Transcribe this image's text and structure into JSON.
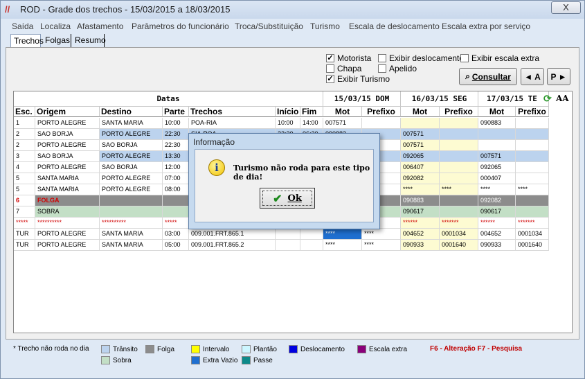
{
  "window": {
    "title": "ROD - Grade dos trechos  - 15/03/2015 a 18/03/2015",
    "close_label": "X"
  },
  "menu": [
    "Saída",
    "Localiza",
    "Afastamento",
    "Parâmetros do funcionário",
    "Troca/Substituição",
    "Turismo",
    "Escala de deslocamento",
    "Escala extra por serviço"
  ],
  "tabs": [
    {
      "label": "Trechos",
      "active": true
    },
    {
      "label": "Folgas",
      "active": false
    },
    {
      "label": "Resumo",
      "active": false
    }
  ],
  "options": {
    "motorista": {
      "label": "Motorista",
      "checked": true
    },
    "chapa": {
      "label": "Chapa",
      "checked": false
    },
    "exibir_turismo": {
      "label": "Exibir Turismo",
      "checked": true
    },
    "exibir_deslocamento": {
      "label": "Exibir deslocamento",
      "checked": false
    },
    "apelido": {
      "label": "Apelido",
      "checked": false
    },
    "exibir_escala_extra": {
      "label": "Exibir escala extra",
      "checked": false
    }
  },
  "buttons": {
    "consultar": "Consultar",
    "prev": "A",
    "next": "P"
  },
  "grid": {
    "group_headers": {
      "datas": "Datas",
      "d1": "15/03/15 DOM",
      "d2": "16/03/15 SEG",
      "d3": "17/03/15 TE"
    },
    "columns": [
      "Esc.",
      "Origem",
      "Destino",
      "Parte",
      "Trechos",
      "Início",
      "Fim",
      "Mot",
      "Prefixo",
      "Mot",
      "Prefixo",
      "Mot",
      "Prefixo"
    ],
    "rows": [
      [
        "1",
        "PORTO ALEGRE",
        "SANTA MARIA",
        "10:00",
        "POA-RIA",
        "10:00",
        "14:00",
        "007571",
        "",
        "",
        "",
        "090883",
        ""
      ],
      [
        "2",
        "SAO BORJA",
        "PORTO ALEGRE",
        "22:30",
        "SIA-POA",
        "22:30",
        "06:30",
        "090883",
        "",
        "007571",
        "",
        "",
        ""
      ],
      [
        "2",
        "PORTO ALEGRE",
        "SAO BORJA",
        "22:30",
        "",
        "",
        "",
        "",
        "",
        "007571",
        "",
        "",
        ""
      ],
      [
        "3",
        "SAO BORJA",
        "PORTO ALEGRE",
        "13:30",
        "",
        "",
        "",
        "",
        "",
        "092065",
        "",
        "007571",
        ""
      ],
      [
        "4",
        "PORTO ALEGRE",
        "SAO BORJA",
        "12:00",
        "",
        "",
        "",
        "",
        "",
        "006407",
        "",
        "092065",
        ""
      ],
      [
        "5",
        "SANTA MARIA",
        "PORTO ALEGRE",
        "07:00",
        "",
        "",
        "",
        "",
        "",
        "092082",
        "",
        "000407",
        ""
      ],
      [
        "5",
        "SANTA MARIA",
        "PORTO ALEGRE",
        "08:00",
        "",
        "",
        "",
        "",
        "",
        "****",
        "****",
        "****",
        "****"
      ],
      [
        "6",
        "FOLGA",
        "",
        "",
        "",
        "",
        "",
        "",
        "",
        "090883",
        "",
        "092082",
        ""
      ],
      [
        "7",
        "SOBRA",
        "",
        "",
        "",
        "",
        "",
        "",
        "",
        "090617",
        "",
        "090617",
        ""
      ],
      [
        "*****",
        "**********",
        "**********",
        "*****",
        "",
        "",
        "",
        "",
        "",
        "******",
        "*******",
        "******",
        "*******"
      ],
      [
        "TUR",
        "PORTO ALEGRE",
        "SANTA MARIA",
        "03:00",
        "009.001.FRT.865.1",
        "",
        "",
        "****",
        "****",
        "004652",
        "0001034",
        "004652",
        "0001034"
      ],
      [
        "TUR",
        "PORTO ALEGRE",
        "SANTA MARIA",
        "05:00",
        "009.001.FRT.865.2",
        "",
        "",
        "****",
        "****",
        "090933",
        "0001640",
        "090933",
        "0001640"
      ]
    ]
  },
  "legend": {
    "note": "* Trecho não roda no dia",
    "items": [
      {
        "label": "Trânsito",
        "color": "#bcd3ee"
      },
      {
        "label": "Sobra",
        "color": "#c3dfc6"
      },
      {
        "label": "Folga",
        "color": "#8c8c8c"
      },
      {
        "label": "Intervalo",
        "color": "#ffff00"
      },
      {
        "label": "Extra Vazio",
        "color": "#1f6fd0"
      },
      {
        "label": "Plantão",
        "color": "#ccf6ff"
      },
      {
        "label": "Passe",
        "color": "#0d8a8a"
      },
      {
        "label": "Deslocamento",
        "color": "#0000e0"
      },
      {
        "label": "Escala extra",
        "color": "#8a007a"
      }
    ],
    "shortcuts": "F6 - Alteração  F7 - Pesquisa"
  },
  "dialog": {
    "title": "Informação",
    "message": "Turismo não roda para este tipo de dia!",
    "ok_label": "Ok"
  },
  "colors": {
    "transito": "#bcd3ee",
    "folga": "#8c8c8c",
    "sobra": "#c3dfc6",
    "intervalo_cell": "#fdfbd2",
    "selection": "#1f6fd0",
    "red_text": "#d00000"
  }
}
